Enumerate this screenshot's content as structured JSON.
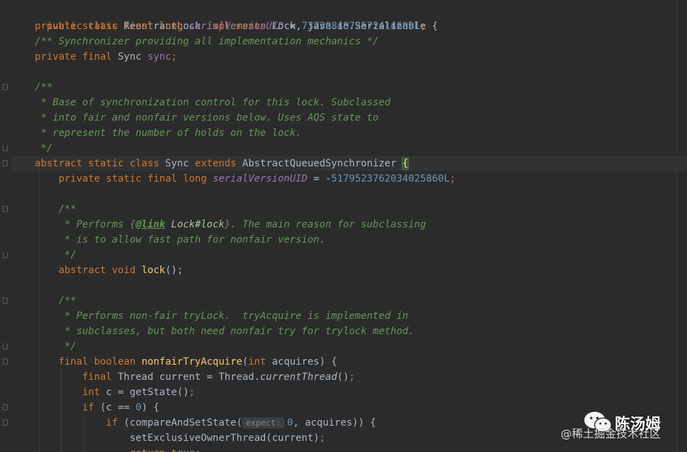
{
  "code": {
    "l1": {
      "a": "public class ",
      "b": "ReentrantLock ",
      "c": "implements ",
      "d": "Lock, java.io.Serializable {"
    },
    "l2": {
      "a": "private static final long ",
      "b": "serialVersionUID",
      "c": " = ",
      "d": "7373984872572414699L",
      "e": ";"
    },
    "l3": {
      "a": "/** Synchronizer providing all implementation mechanics */"
    },
    "l4": {
      "a": "private final ",
      "b": "Sync ",
      "c": "sync",
      "d": ";"
    },
    "l6": {
      "a": "/**"
    },
    "l7": {
      "a": " * Base of synchronization control for this lock. Subclassed"
    },
    "l8": {
      "a": " * into fair and nonfair versions below. Uses AQS state to"
    },
    "l9": {
      "a": " * represent the number of holds on the lock."
    },
    "l10": {
      "a": " */"
    },
    "l11": {
      "a": "abstract static class ",
      "b": "Sync ",
      "c": "extends ",
      "d": "AbstractQueuedSynchronizer ",
      "e": "{"
    },
    "l12": {
      "a": "private static final long ",
      "b": "serialVersionUID",
      "c": " = -",
      "d": "5179523762034025860L",
      "e": ";"
    },
    "l14": {
      "a": "/**"
    },
    "l15": {
      "a": " * Performs {",
      "b": "@link",
      "c": " Lock#lock",
      "d": "}. The main reason for subclassing"
    },
    "l16": {
      "a": " * is to allow fast path for nonfair version."
    },
    "l17": {
      "a": " */"
    },
    "l18": {
      "a": "abstract void ",
      "b": "lock",
      "c": "();"
    },
    "l20": {
      "a": "/**"
    },
    "l21": {
      "a": " * Performs non-fair tryLock.  tryAcquire is implemented in"
    },
    "l22": {
      "a": " * subclasses, but both need nonfair try for trylock method."
    },
    "l23": {
      "a": " */"
    },
    "l24": {
      "a": "final boolean ",
      "b": "nonfairTryAcquire",
      "c": "(",
      "d": "int ",
      "e": "acquires) {"
    },
    "l25": {
      "a": "final ",
      "b": "Thread current = Thread.",
      "c": "currentThread",
      "d": "()",
      "e": ";"
    },
    "l26": {
      "a": "int ",
      "b": "c = getState()",
      "c": ";"
    },
    "l27": {
      "a": "if ",
      "b": "(c == ",
      "c": "0",
      "d": ") {"
    },
    "l28": {
      "a": "if ",
      "b": "(compareAndSetState(",
      "hint": "expect:",
      "c": "0",
      "d": ", acquires)) {"
    },
    "l29": {
      "a": "setExclusiveOwnerThread(current)",
      "b": ";"
    },
    "l30": {
      "a": "return ",
      "b": "true",
      "c": ";"
    }
  },
  "watermark": {
    "name": "陈汤姆",
    "site": "@稀土掘金技术社区"
  },
  "colors": {
    "background": "#2b2b2b",
    "keyword": "#cc7832",
    "comment": "#629755",
    "field": "#9876aa",
    "number": "#6897bb",
    "method": "#ffc66d",
    "text": "#a9b7c6"
  }
}
